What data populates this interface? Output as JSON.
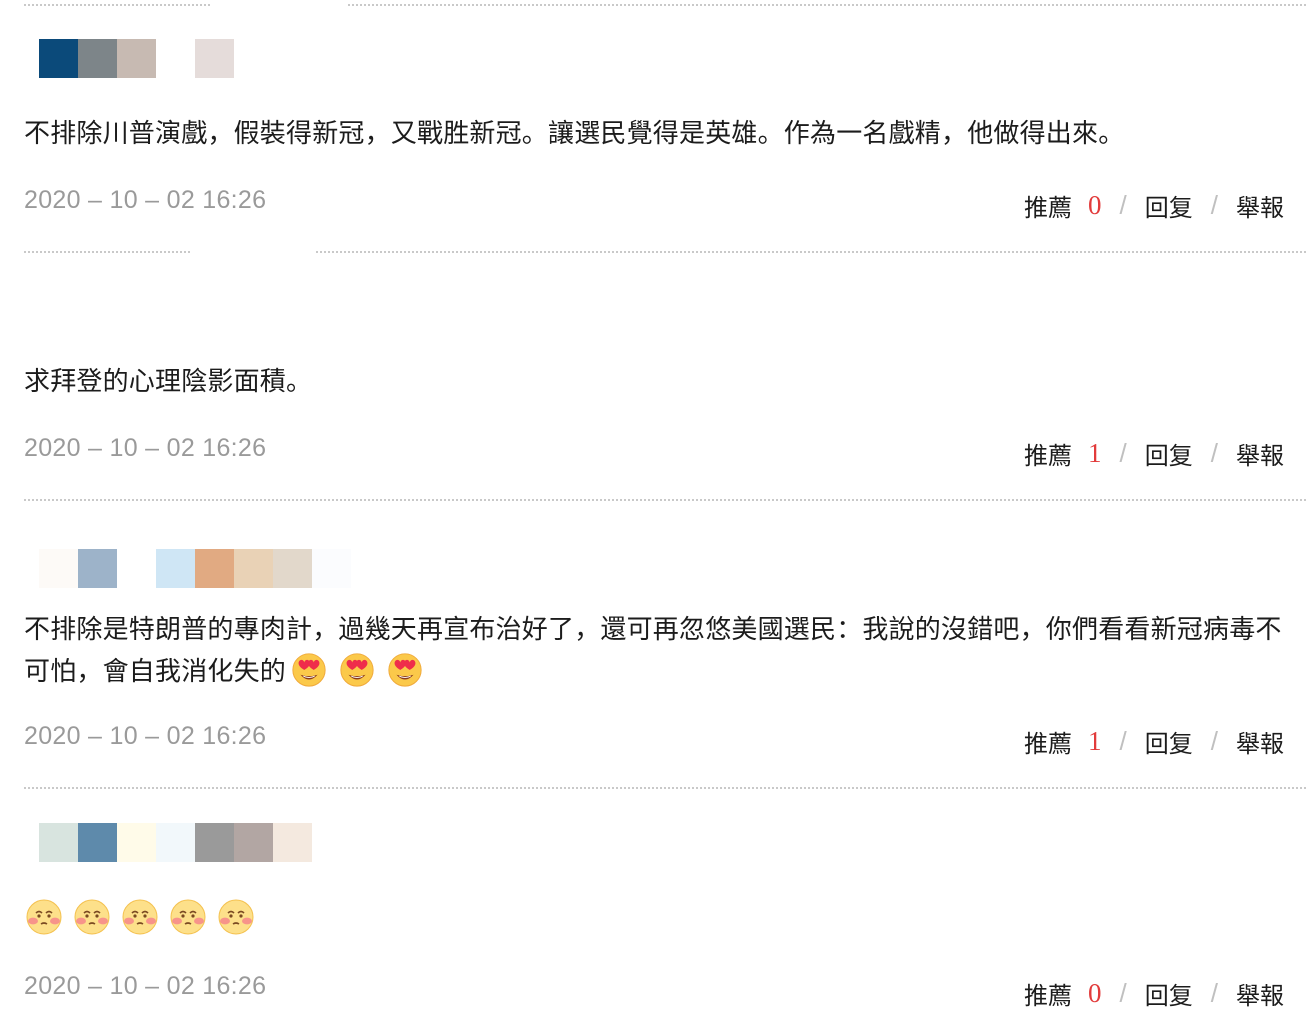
{
  "comments": [
    {
      "avatar_colors": [
        "#0b4a7a",
        "#7d8589",
        "#c7bab2",
        "#ffffff",
        "#e5dcda"
      ],
      "text": "不排除川普演戲，假裝得新冠，又戰胜新冠。讓選民覺得是英雄。作為一名戲精，他做得出來。",
      "timestamp": "2020 – 10 – 02 16:26",
      "recommend_label": "推薦",
      "recommend_count": "0",
      "reply_label": "回复",
      "report_label": "舉報"
    },
    {
      "avatar_colors": [],
      "text": "求拜登的心理陰影面積。",
      "timestamp": "2020 – 10 – 02 16:26",
      "recommend_label": "推薦",
      "recommend_count": "1",
      "reply_label": "回复",
      "report_label": "舉報"
    },
    {
      "avatar_colors": [
        "#fdfaf7",
        "#9db3c9",
        "#ffffff",
        "#cfe6f5",
        "#e1aa82",
        "#e9d2b6",
        "#e2d8cb",
        "#fbfcfe"
      ],
      "text": "不排除是特朗普的專肉計，過幾天再宣布治好了，還可再忽悠美國選民：我說的沒錯吧，你們看看新冠病毒不可怕，會自我消化失的",
      "emojis": [
        "heart-eyes",
        "heart-eyes",
        "heart-eyes"
      ],
      "timestamp": "2020 – 10 – 02 16:26",
      "recommend_label": "推薦",
      "recommend_count": "1",
      "reply_label": "回复",
      "report_label": "舉報"
    },
    {
      "avatar_colors": [
        "#d8e4df",
        "#5e8aab",
        "#fffbe9",
        "#f2f8fb",
        "#9a9a9a",
        "#b2a6a3",
        "#f4e9df"
      ],
      "text": "",
      "emojis": [
        "blush",
        "blush",
        "blush",
        "blush",
        "blush"
      ],
      "timestamp": "2020 – 10 – 02 16:26",
      "recommend_label": "推薦",
      "recommend_count": "0",
      "reply_label": "回复",
      "report_label": "舉報"
    }
  ],
  "colors": {
    "count": "#e23b3b",
    "timestamp": "#9a9a9a",
    "divider": "#c9c9c9"
  }
}
